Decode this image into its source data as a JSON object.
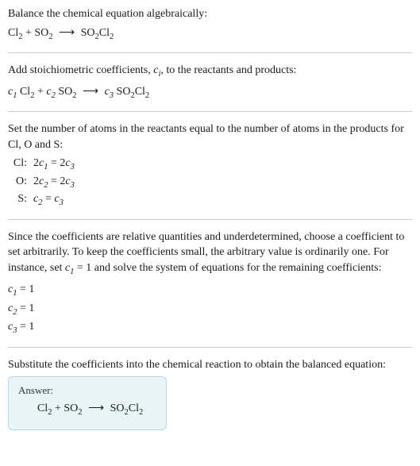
{
  "intro": {
    "line1": "Balance the chemical equation algebraically:",
    "eq_lhs1": "Cl",
    "eq_lhs1_sub": "2",
    "plus": " + ",
    "eq_lhs2": "SO",
    "eq_lhs2_sub": "2",
    "arrow": "⟶",
    "eq_rhs": "SO",
    "eq_rhs_sub1": "2",
    "eq_rhs2": "Cl",
    "eq_rhs_sub2": "2"
  },
  "step2": {
    "text_a": "Add stoichiometric coefficients, ",
    "ci": "c",
    "ci_sub": "i",
    "text_b": ", to the reactants and products:",
    "c1": "c",
    "c1_sub": "1",
    "sp": " ",
    "cl": "Cl",
    "cl_sub": "2",
    "plus": " + ",
    "c2": "c",
    "c2_sub": "2",
    "so": "SO",
    "so_sub": "2",
    "arrow": "⟶",
    "c3": "c",
    "c3_sub": "3",
    "socl": "SO",
    "socl_sub1": "2",
    "socl2": "Cl",
    "socl_sub2": "2"
  },
  "step3": {
    "text": "Set the number of atoms in the reactants equal to the number of atoms in the products for Cl, O and S:",
    "rows": [
      {
        "label": "Cl:",
        "lhs_coef": "2",
        "lhs_c": "c",
        "lhs_sub": "1",
        "eq": " = ",
        "rhs_coef": "2",
        "rhs_c": "c",
        "rhs_sub": "3"
      },
      {
        "label": "O:",
        "lhs_coef": "2",
        "lhs_c": "c",
        "lhs_sub": "2",
        "eq": " = ",
        "rhs_coef": "2",
        "rhs_c": "c",
        "rhs_sub": "3"
      },
      {
        "label": "S:",
        "lhs_coef": "",
        "lhs_c": "c",
        "lhs_sub": "2",
        "eq": " = ",
        "rhs_coef": "",
        "rhs_c": "c",
        "rhs_sub": "3"
      }
    ]
  },
  "step4": {
    "text_a": "Since the coefficients are relative quantities and underdetermined, choose a coefficient to set arbitrarily. To keep the coefficients small, the arbitrary value is ordinarily one. For instance, set ",
    "c1": "c",
    "c1_sub": "1",
    "text_b": " = 1 and solve the system of equations for the remaining coefficients:",
    "coeffs": [
      {
        "c": "c",
        "sub": "1",
        "val": " = 1"
      },
      {
        "c": "c",
        "sub": "2",
        "val": " = 1"
      },
      {
        "c": "c",
        "sub": "3",
        "val": " = 1"
      }
    ]
  },
  "step5": {
    "text": "Substitute the coefficients into the chemical reaction to obtain the balanced equation:"
  },
  "answer": {
    "label": "Answer:",
    "cl": "Cl",
    "cl_sub": "2",
    "plus": " + ",
    "so": "SO",
    "so_sub": "2",
    "arrow": "⟶",
    "socl": "SO",
    "socl_sub1": "2",
    "socl2": "Cl",
    "socl_sub2": "2"
  }
}
